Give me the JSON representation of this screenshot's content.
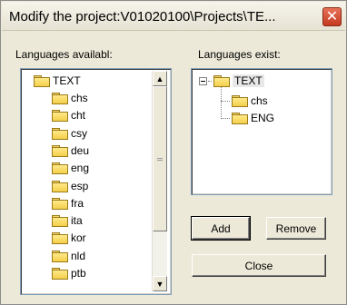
{
  "dialog": {
    "title": "Modify the project:V01020100\\Projects\\TE...",
    "close_symbol": "✕"
  },
  "available": {
    "label": "Languages availabl:",
    "root": "TEXT",
    "items": [
      "chs",
      "cht",
      "csy",
      "deu",
      "eng",
      "esp",
      "fra",
      "ita",
      "kor",
      "nld",
      "ptb"
    ]
  },
  "existing": {
    "label": "Languages exist:",
    "root": "TEXT",
    "items": [
      "chs",
      "ENG"
    ]
  },
  "buttons": {
    "add": "Add",
    "remove": "Remove",
    "close": "Close"
  },
  "icons": {
    "folder": "folder-icon",
    "scroll_up": "scroll-up-arrow-icon",
    "scroll_down": "scroll-down-arrow-icon",
    "collapse": "tree-collapse-icon",
    "close": "close-icon"
  }
}
